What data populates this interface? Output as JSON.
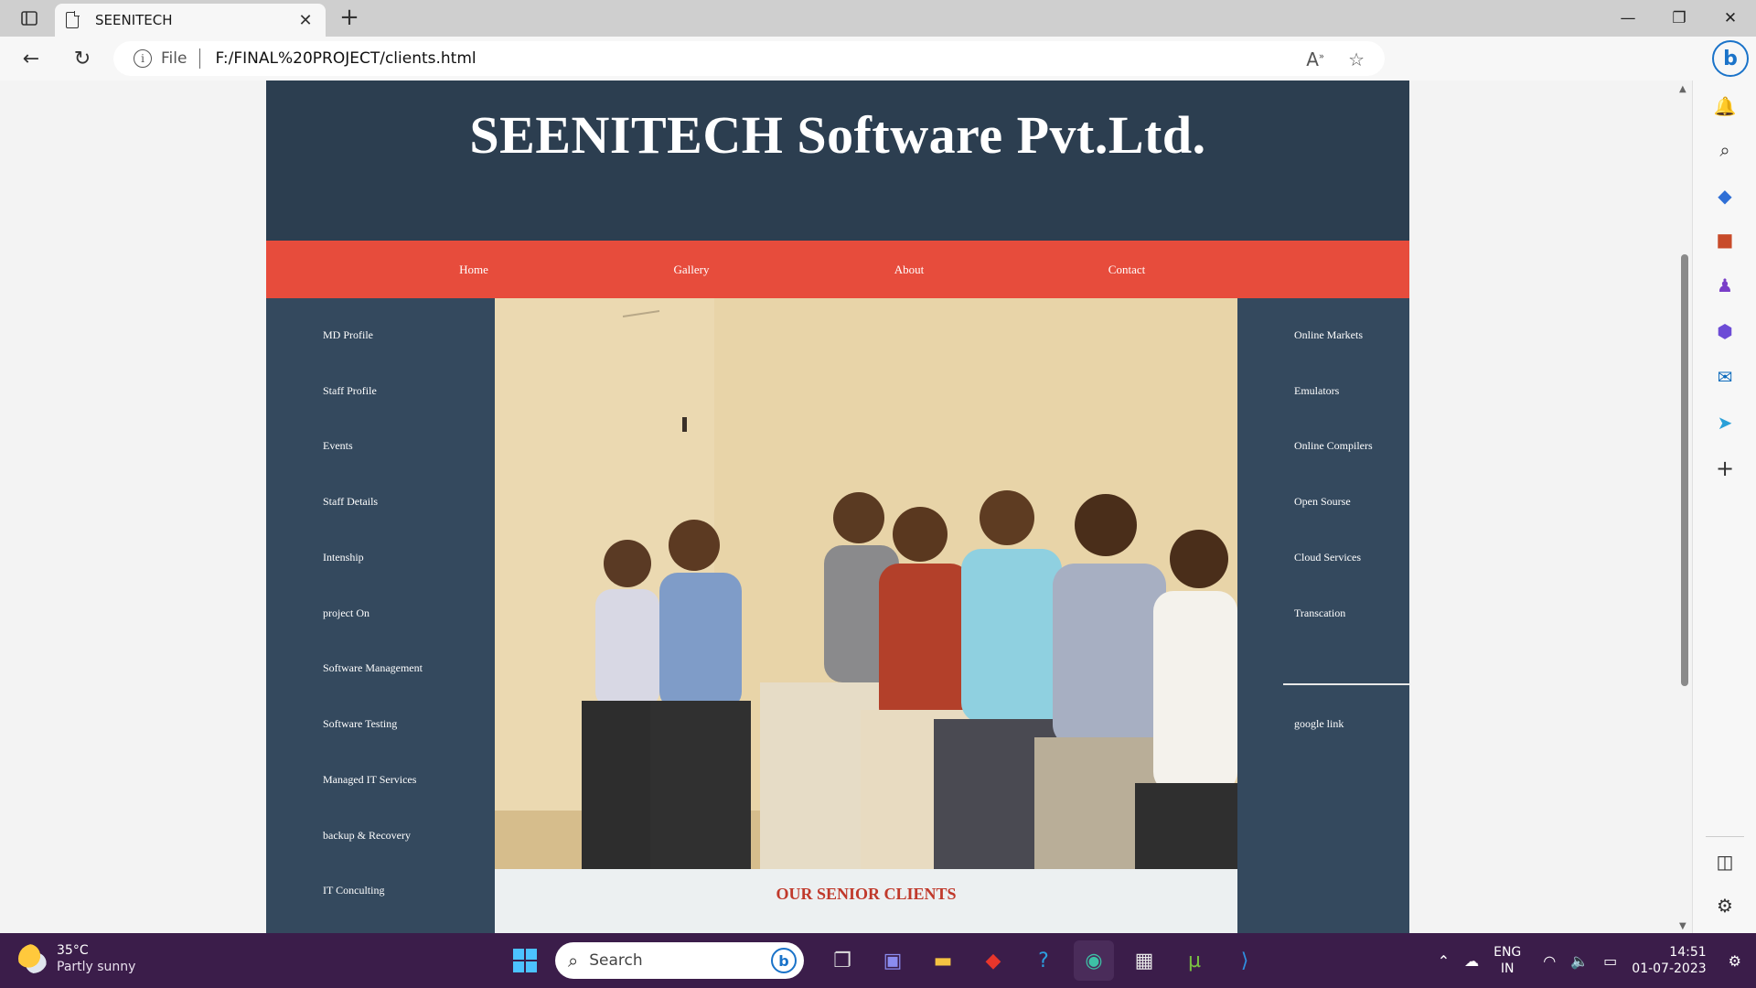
{
  "browser": {
    "tab_title": "SEENITECH",
    "address_prefix": "File",
    "url": "F:/FINAL%20PROJECT/clients.html"
  },
  "page": {
    "site_title": "SEENITECH Software Pvt.Ltd.",
    "nav": [
      "Home",
      "Gallery",
      "About",
      "Contact"
    ],
    "left_menu": [
      "MD Profile",
      "Staff Profile",
      "Events",
      "Staff Details",
      "Intenship",
      "project On",
      "Software Management",
      "Software Testing",
      "Managed IT Services",
      "backup & Recovery",
      "IT Conculting"
    ],
    "right_menu": [
      "Online Markets",
      "Emulators",
      "Online Compilers",
      "Open Sourse",
      "Cloud Services",
      "Transcation"
    ],
    "right_link": "google link",
    "clients_heading": "OUR SENIOR CLIENTS",
    "colors": {
      "header_bg": "#2c3e50",
      "nav_bg": "#e74c3c",
      "sidebar_bg": "#34495e",
      "heading_red": "#c0392b"
    }
  },
  "taskbar": {
    "temperature": "35°C",
    "weather": "Partly sunny",
    "search_label": "Search",
    "lang_top": "ENG",
    "lang_bottom": "IN",
    "time": "14:51",
    "date": "01-07-2023"
  }
}
